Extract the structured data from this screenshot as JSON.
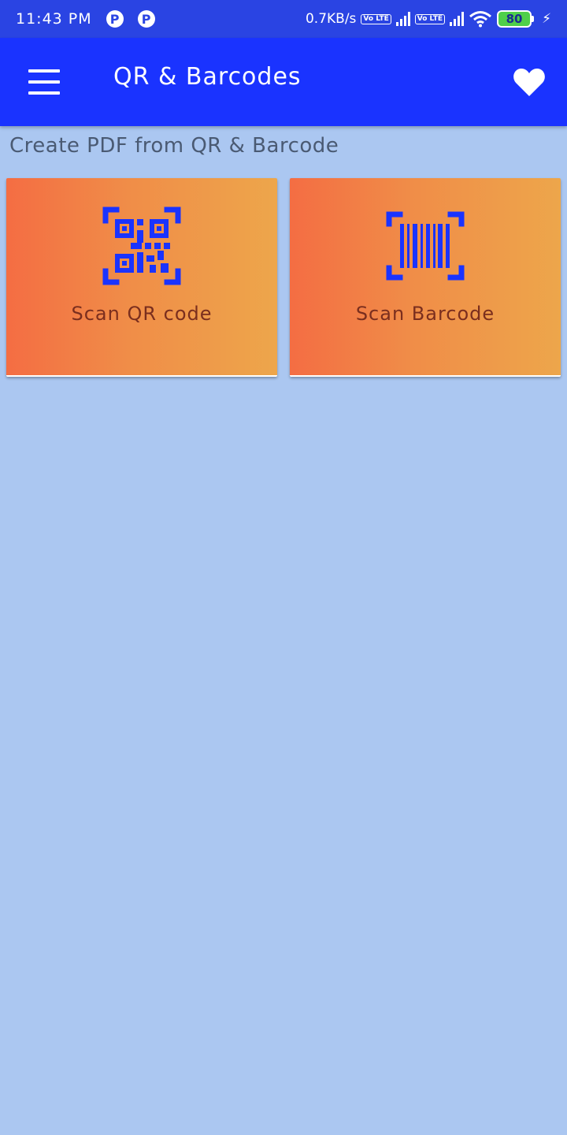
{
  "status_bar": {
    "time": "11:43 PM",
    "notif_icon_1": "P",
    "notif_icon_2": "P",
    "net_speed": "0.7KB/s",
    "volte_label": "Vo LTE",
    "battery_level": "80",
    "battery_color": "#4fcf4a"
  },
  "app_bar": {
    "title": "QR & Barcodes",
    "menu_icon": "hamburger-menu-icon",
    "favorite_icon": "heart-icon",
    "color": "#1a33ff"
  },
  "main": {
    "subtitle": "Create PDF from QR & Barcode",
    "cards": [
      {
        "label": "Scan QR code",
        "icon": "qr-code-scan-icon"
      },
      {
        "label": "Scan Barcode",
        "icon": "barcode-scan-icon"
      }
    ],
    "icon_color": "#1a33ff",
    "background": "#abc7f1"
  }
}
